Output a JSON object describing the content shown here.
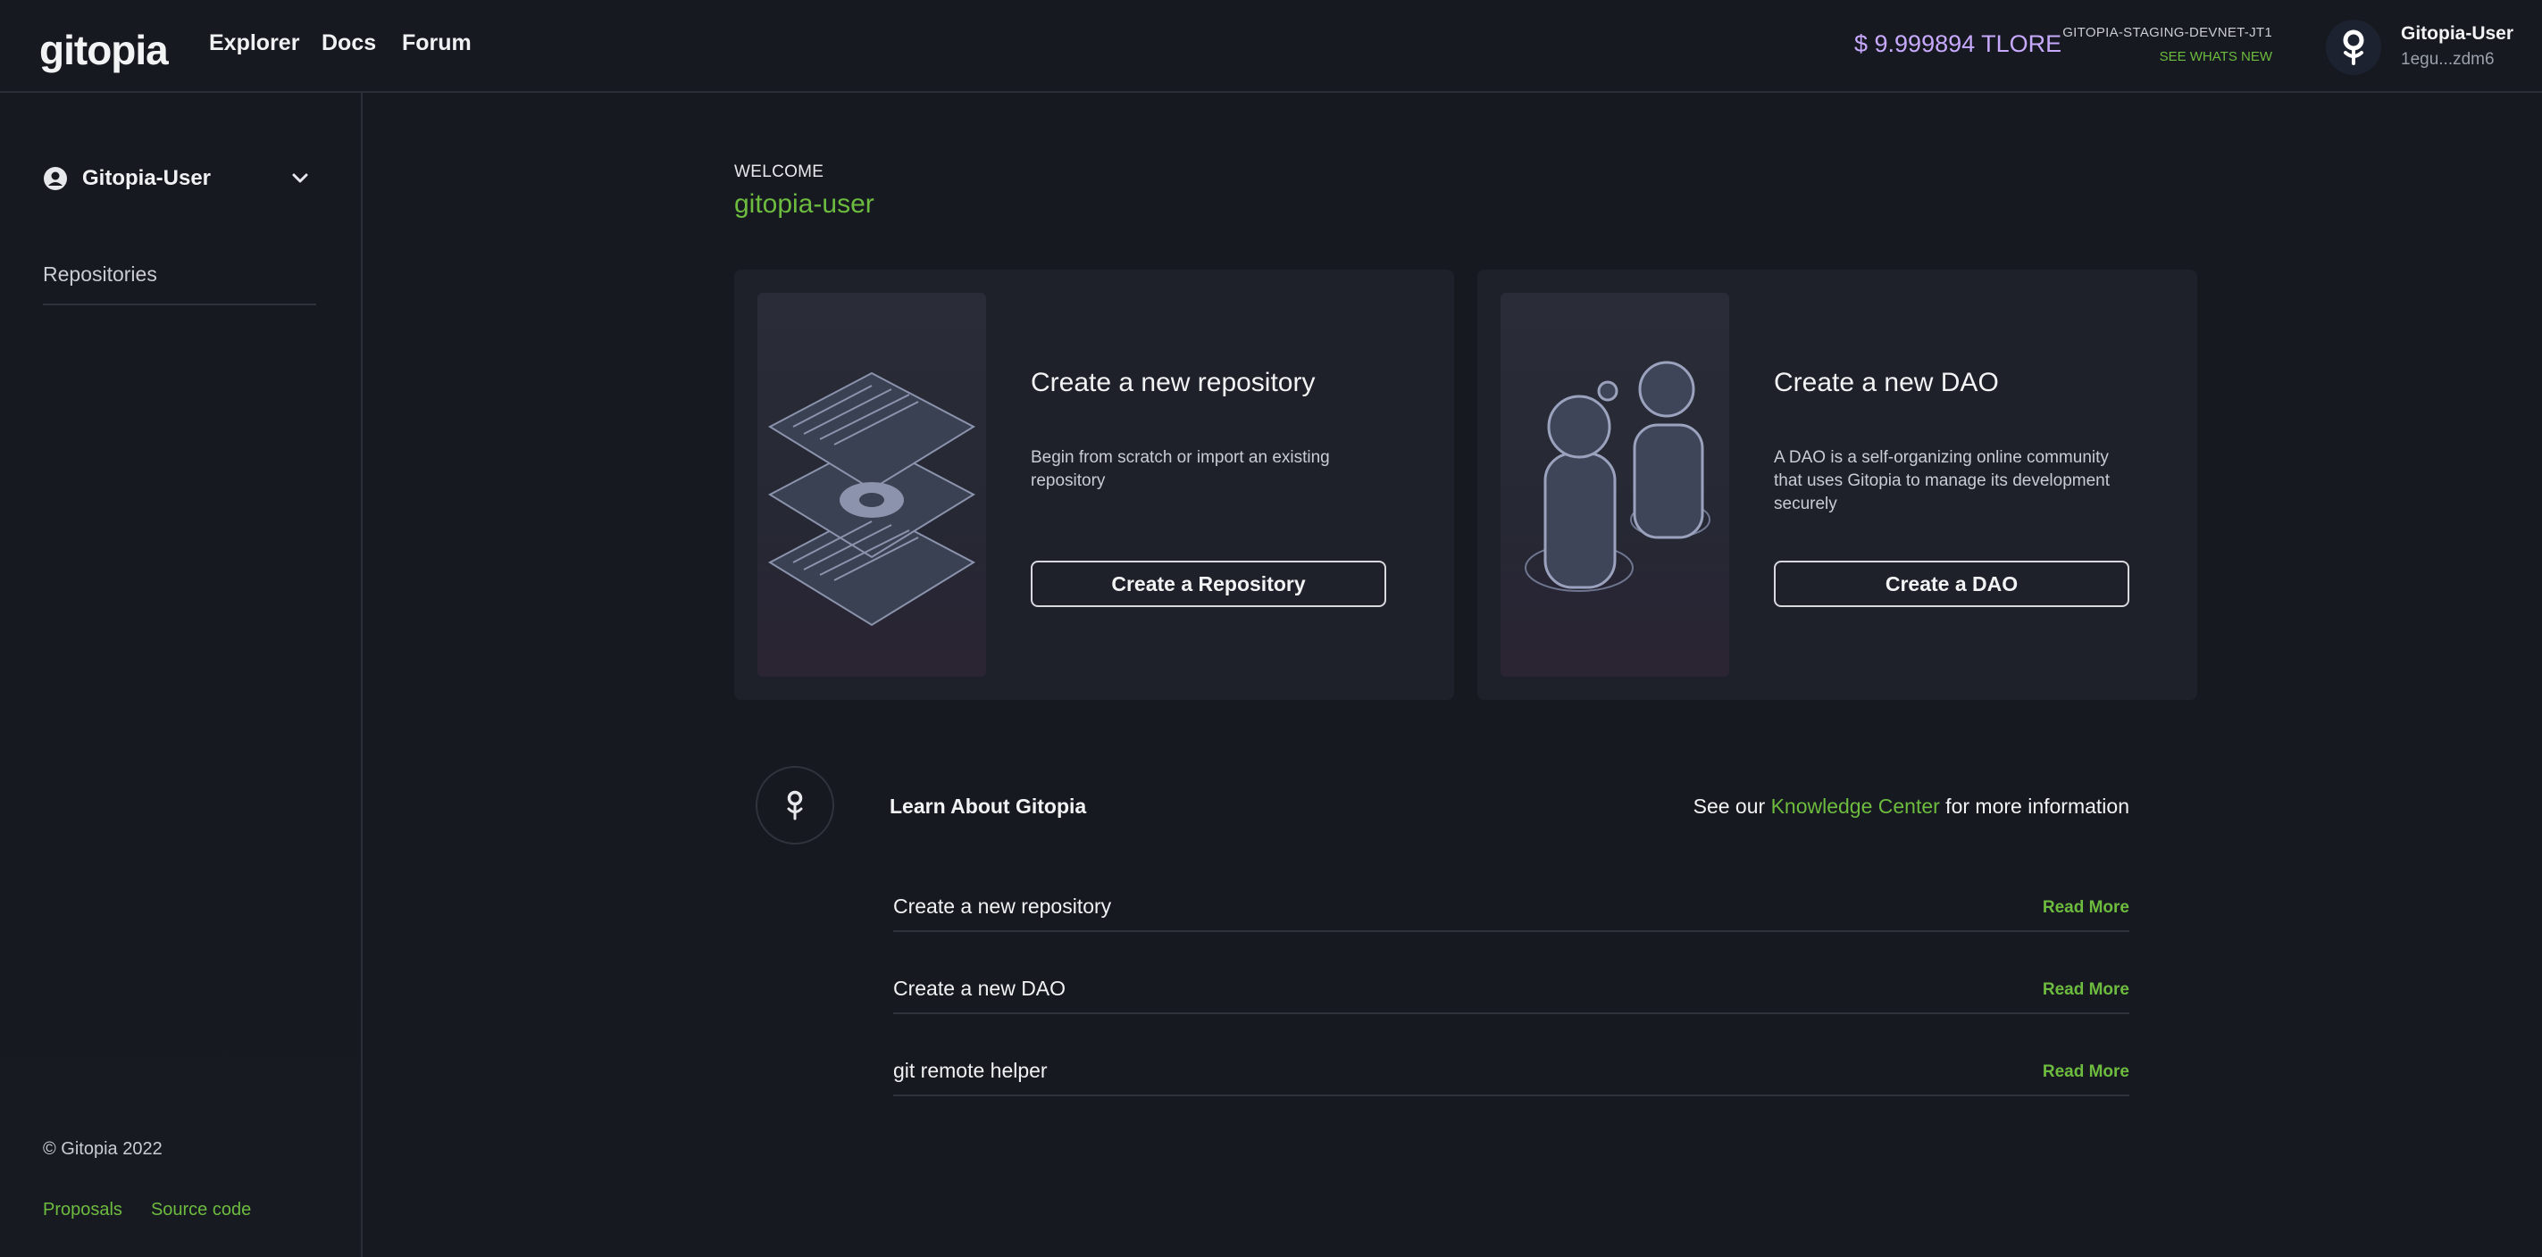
{
  "header": {
    "logo_text": "gitopia",
    "nav": [
      {
        "label": "Explorer"
      },
      {
        "label": "Docs"
      },
      {
        "label": "Forum"
      }
    ],
    "balance": "$ 9.999894 TLORE",
    "network_name": "GITOPIA-STAGING-DEVNET-JT1",
    "network_link": "SEE WHATS NEW",
    "user_name": "Gitopia-User",
    "user_address": "1egu...zdm6"
  },
  "sidebar": {
    "account_label": "Gitopia-User",
    "items": [
      {
        "label": "Repositories"
      }
    ],
    "copyright": "© Gitopia 2022",
    "footer_links": [
      {
        "label": "Proposals"
      },
      {
        "label": "Source code"
      }
    ]
  },
  "main": {
    "welcome_label": "WELCOME",
    "welcome_user": "gitopia-user",
    "cards": [
      {
        "title": "Create a new repository",
        "description": "Begin from scratch or import an existing repository",
        "button": "Create a Repository"
      },
      {
        "title": "Create a new DAO",
        "description": "A DAO is a self-organizing online community that uses Gitopia to manage its development securely",
        "button": "Create a DAO"
      }
    ],
    "learn": {
      "title": "Learn About Gitopia",
      "prefix": "See our ",
      "link": "Knowledge Center",
      "suffix": " for more information",
      "topics": [
        {
          "label": "Create a new repository",
          "action": "Read More"
        },
        {
          "label": "Create a new DAO",
          "action": "Read More"
        },
        {
          "label": "git remote helper",
          "action": "Read More"
        }
      ]
    }
  },
  "colors": {
    "background": "#16191f",
    "accent_green": "#6dbb3f",
    "balance_purple": "#c7a9ff",
    "card_bg": "#1e2129"
  },
  "icons": {
    "logo": "gitopia-logo",
    "user_avatar": "gitopia-avatar-icon",
    "account": "user-circle-icon",
    "chevron": "chevron-down-icon",
    "learn": "gitopia-mark-icon"
  }
}
